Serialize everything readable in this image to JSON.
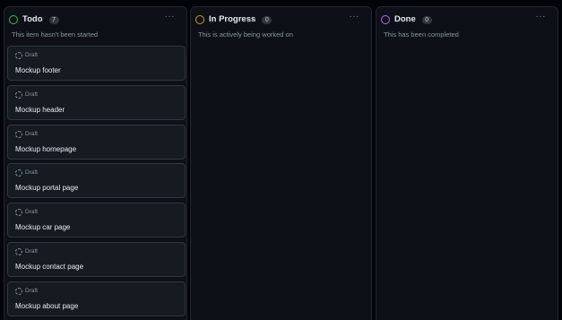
{
  "columns": [
    {
      "name": "Todo",
      "count": "7",
      "description": "This item hasn't been started",
      "status_color": "#3fb950",
      "menu_icon": "kebab-horizontal-icon",
      "menu_label": "···",
      "cards": [
        {
          "status": "Draft",
          "title": "Mockup footer",
          "icon": "draft-icon"
        },
        {
          "status": "Draft",
          "title": "Mockup header",
          "icon": "draft-icon"
        },
        {
          "status": "Draft",
          "title": "Mockup homepage",
          "icon": "draft-icon"
        },
        {
          "status": "Draft",
          "title": "Mockup portal page",
          "icon": "draft-icon"
        },
        {
          "status": "Draft",
          "title": "Mockup car page",
          "icon": "draft-icon"
        },
        {
          "status": "Draft",
          "title": "Mockup contact page",
          "icon": "draft-icon"
        },
        {
          "status": "Draft",
          "title": "Mockup about page",
          "icon": "draft-icon"
        }
      ]
    },
    {
      "name": "In Progress",
      "count": "0",
      "description": "This is actively being worked on",
      "status_color": "#d29922",
      "menu_icon": "kebab-horizontal-icon",
      "menu_label": "···",
      "cards": []
    },
    {
      "name": "Done",
      "count": "0",
      "description": "This has been completed",
      "status_color": "#a371f7",
      "menu_icon": "kebab-horizontal-icon",
      "menu_label": "···",
      "cards": []
    }
  ]
}
